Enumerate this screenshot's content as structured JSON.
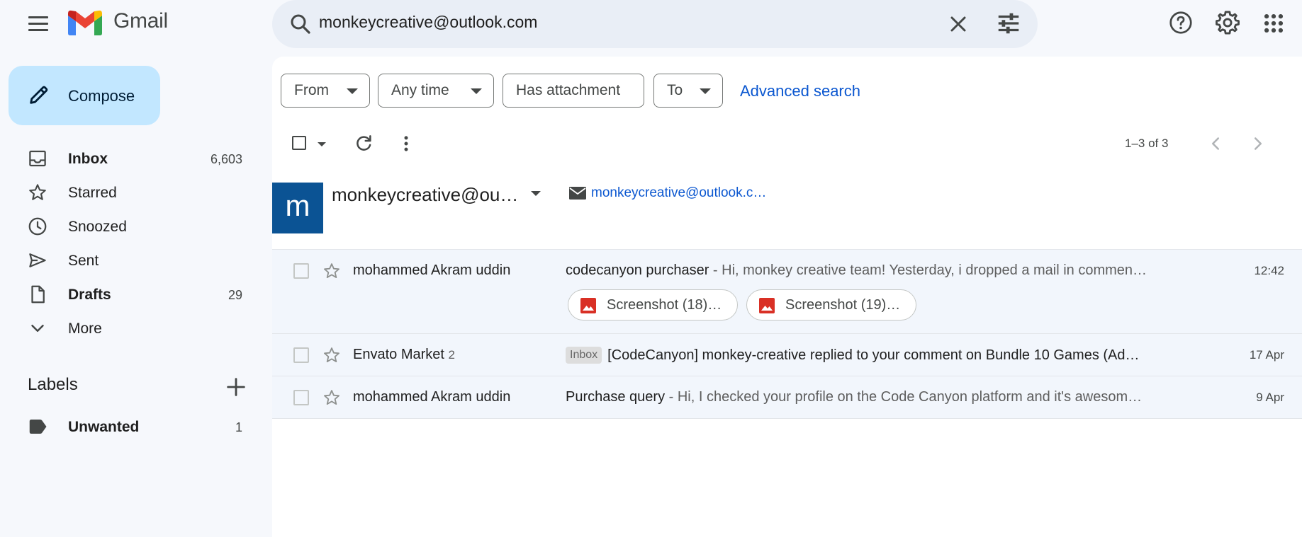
{
  "app": {
    "name": "Gmail",
    "colors": {
      "brand_red": "#ea4335",
      "brand_blue": "#4285f4",
      "brand_green": "#34a853",
      "brand_yellow": "#fbbc04",
      "compose_bg": "#c2e7ff",
      "avatar_bg": "#0b5394",
      "link": "#0b57d0"
    }
  },
  "search": {
    "query": "monkeycreative@outlook.com"
  },
  "compose": {
    "label": "Compose"
  },
  "nav": [
    {
      "label": "Inbox",
      "count": "6,603",
      "icon": "inbox-icon",
      "bold": true
    },
    {
      "label": "Starred",
      "count": "",
      "icon": "star-icon",
      "bold": false
    },
    {
      "label": "Snoozed",
      "count": "",
      "icon": "clock-icon",
      "bold": false
    },
    {
      "label": "Sent",
      "count": "",
      "icon": "send-icon",
      "bold": false
    },
    {
      "label": "Drafts",
      "count": "29",
      "icon": "draft-icon",
      "bold": true
    },
    {
      "label": "More",
      "count": "",
      "icon": "chevron-down-icon",
      "bold": false
    }
  ],
  "labels": {
    "heading": "Labels",
    "items": [
      {
        "label": "Unwanted",
        "count": "1",
        "icon": "label-icon"
      }
    ]
  },
  "filters": {
    "from": "From",
    "any_time": "Any time",
    "has_attachment": "Has attachment",
    "to": "To",
    "advanced": "Advanced search"
  },
  "toolbar": {
    "pager": "1–3 of 3"
  },
  "contact": {
    "initial": "m",
    "name": "monkeycreative@ou…",
    "email": "monkeycreative@outlook.c…"
  },
  "emails": [
    {
      "sender": "mohammed Akram uddin",
      "sender_count": "",
      "tag": "",
      "subject": "codecanyon purchaser",
      "snippet": " - Hi, monkey creative team! Yesterday, i dropped a mail in commen…",
      "date": "12:42",
      "attachments": [
        "Screenshot (18)…",
        "Screenshot (19)…"
      ]
    },
    {
      "sender": "Envato Market",
      "sender_count": "2",
      "tag": "Inbox",
      "subject": "[CodeCanyon] monkey-creative replied to your comment on Bundle 10 Games (Ad…",
      "snippet": "",
      "date": "17 Apr",
      "attachments": []
    },
    {
      "sender": "mohammed Akram uddin",
      "sender_count": "",
      "tag": "",
      "subject": "Purchase query",
      "snippet": " - Hi, I checked your profile on the Code Canyon platform and it's awesom…",
      "date": "9 Apr",
      "attachments": []
    }
  ]
}
